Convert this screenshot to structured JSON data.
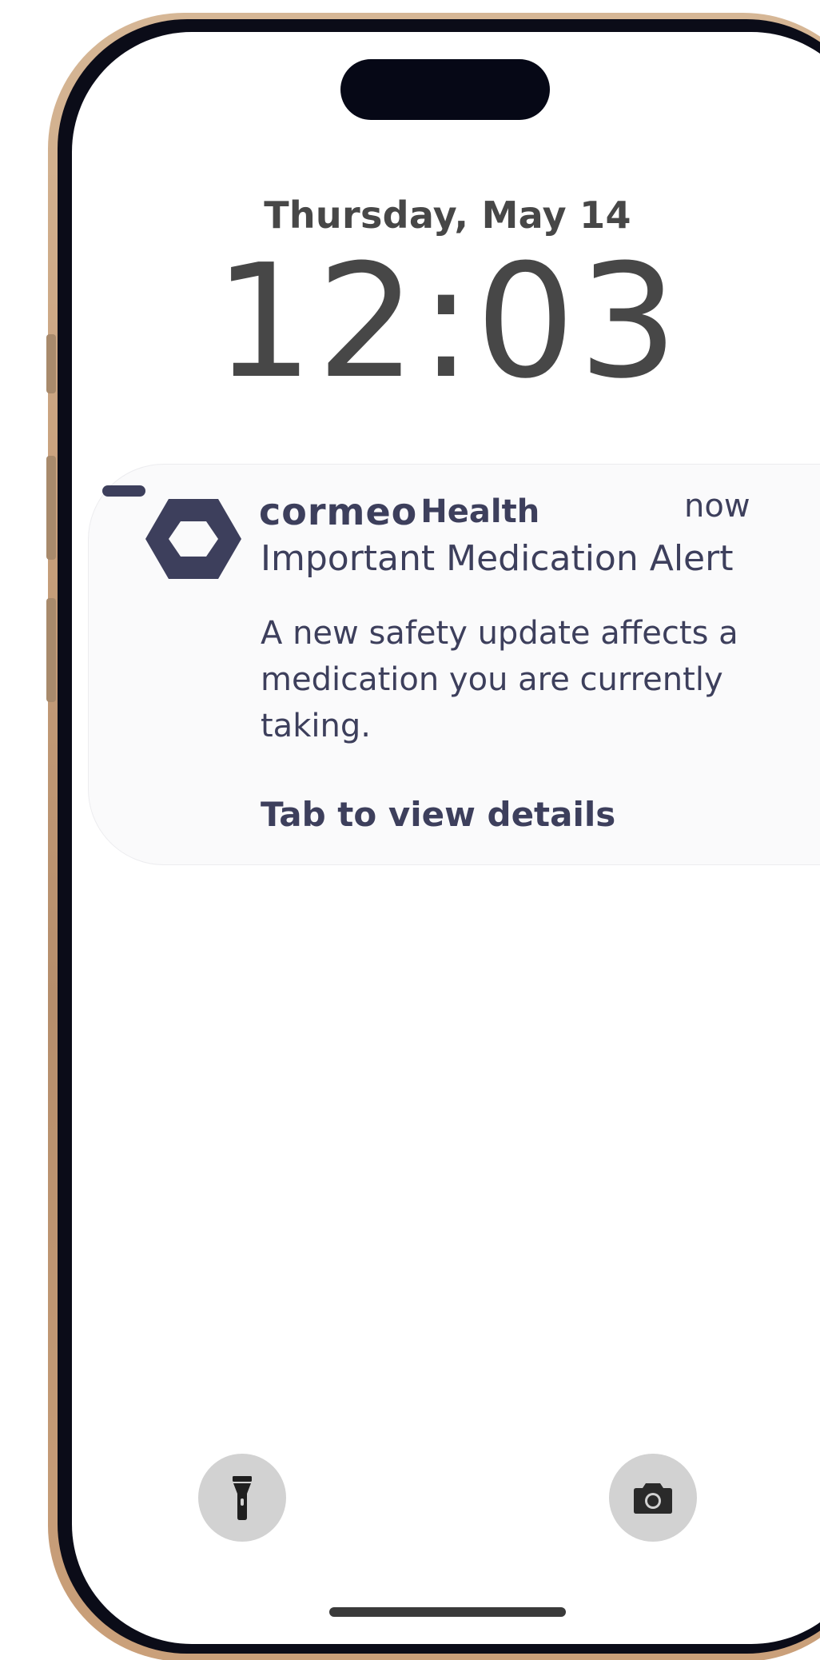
{
  "lock_screen": {
    "date": "Thursday, May 14",
    "time": "12:03"
  },
  "notification": {
    "brand_name": "cormeo",
    "brand_suffix": "Health",
    "timestamp": "now",
    "title": "Important Medication Alert",
    "body": "A new safety update affects a medication you are currently taking.",
    "call_to_action": "Tab to view details",
    "brand_color": "#3d3f5c"
  },
  "quick_actions": {
    "left_icon": "flashlight-icon",
    "right_icon": "camera-icon"
  },
  "colors": {
    "frame_gold": "#c8a07c",
    "bezel": "#0b0c18",
    "text_gray": "#474747",
    "quick_button_bg": "#d2d2d2"
  }
}
